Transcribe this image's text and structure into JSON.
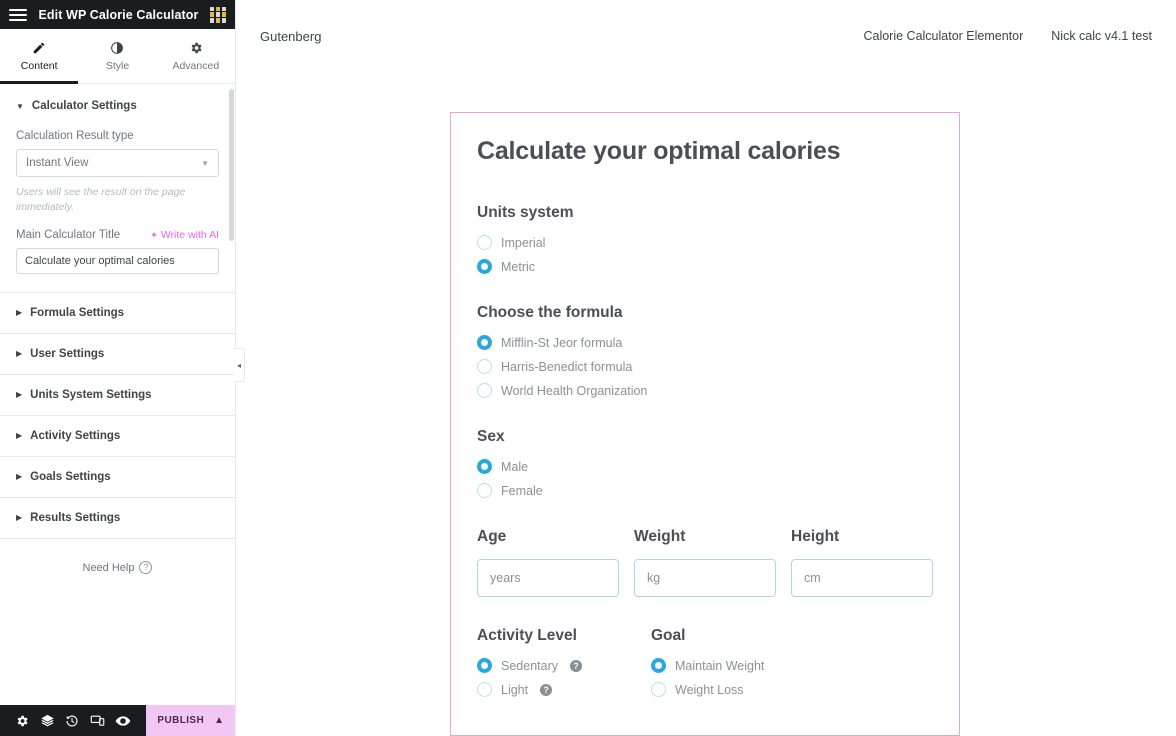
{
  "panel": {
    "header": {
      "title": "Edit WP Calorie Calculator",
      "menu_icon": "hamburger-icon",
      "widgets_icon": "grid-icon"
    },
    "tabs": [
      {
        "label": "Content",
        "icon": "pencil-icon",
        "active": true
      },
      {
        "label": "Style",
        "icon": "contrast-icon",
        "active": false
      },
      {
        "label": "Advanced",
        "icon": "gear-icon",
        "active": false
      }
    ],
    "open_section": {
      "title": "Calculator Settings",
      "result_type_label": "Calculation Result type",
      "result_type_value": "Instant View",
      "result_type_hint": "Users will see the result on the page immediately.",
      "main_title_label": "Main Calculator Title",
      "ai_link_label": "Write with AI",
      "main_title_value": "Calculate your optimal calories"
    },
    "sections": [
      {
        "title": "Formula Settings"
      },
      {
        "title": "User Settings"
      },
      {
        "title": "Units System Settings"
      },
      {
        "title": "Activity Settings"
      },
      {
        "title": "Goals Settings"
      },
      {
        "title": "Results Settings"
      }
    ],
    "need_help": "Need Help",
    "bottom_bar": {
      "icons": [
        "gear-icon",
        "layers-icon",
        "history-icon",
        "responsive-icon",
        "preview-icon"
      ],
      "publish_label": "PUBLISH",
      "publish_chevron": "chevron-up-icon",
      "publish_color": "#f3c7f3"
    }
  },
  "topnav": {
    "brand": "Gutenberg",
    "links": [
      "Calorie Calculator Elementor",
      "Nick calc v4.1 test"
    ]
  },
  "calculator": {
    "title": "Calculate your optimal calories",
    "accent_color": "#29a8dd",
    "frame_color": "#e8a5d8",
    "groups": [
      {
        "title": "Units system",
        "options": [
          {
            "label": "Imperial",
            "selected": false
          },
          {
            "label": "Metric",
            "selected": true
          }
        ]
      },
      {
        "title": "Choose the formula",
        "options": [
          {
            "label": "Mifflin-St Jeor formula",
            "selected": true
          },
          {
            "label": "Harris-Benedict formula",
            "selected": false
          },
          {
            "label": "World Health Organization",
            "selected": false
          }
        ]
      },
      {
        "title": "Sex",
        "options": [
          {
            "label": "Male",
            "selected": true
          },
          {
            "label": "Female",
            "selected": false
          }
        ]
      }
    ],
    "fields": [
      {
        "label": "Age",
        "placeholder": "years",
        "value": ""
      },
      {
        "label": "Weight",
        "placeholder": "kg",
        "value": ""
      },
      {
        "label": "Height",
        "placeholder": "cm",
        "value": ""
      }
    ],
    "activity": {
      "title": "Activity Level",
      "options": [
        {
          "label": "Sedentary",
          "selected": true,
          "help": true
        },
        {
          "label": "Light",
          "selected": false,
          "help": true
        }
      ]
    },
    "goal": {
      "title": "Goal",
      "options": [
        {
          "label": "Maintain Weight",
          "selected": true,
          "help": false
        },
        {
          "label": "Weight Loss",
          "selected": false,
          "help": false
        }
      ]
    }
  }
}
